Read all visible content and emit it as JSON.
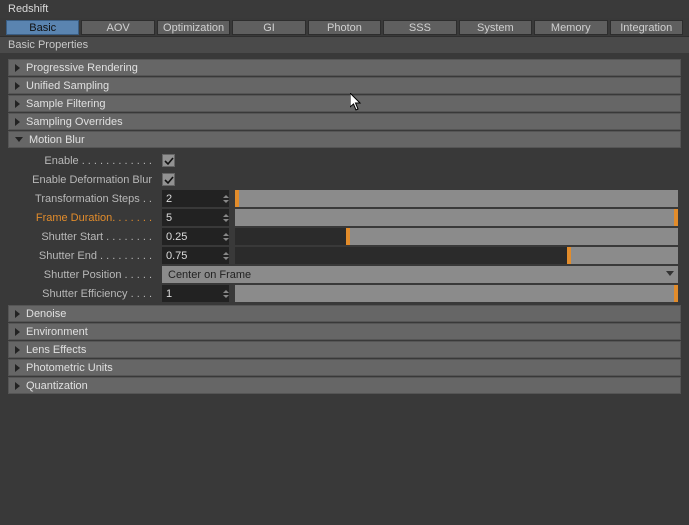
{
  "window": {
    "title": "Redshift"
  },
  "tabs": [
    {
      "label": "Basic",
      "active": true
    },
    {
      "label": "AOV"
    },
    {
      "label": "Optimization"
    },
    {
      "label": "GI"
    },
    {
      "label": "Photon"
    },
    {
      "label": "SSS"
    },
    {
      "label": "System"
    },
    {
      "label": "Memory"
    },
    {
      "label": "Integration"
    }
  ],
  "section": {
    "title": "Basic Properties"
  },
  "groups_top": [
    {
      "label": "Progressive Rendering"
    },
    {
      "label": "Unified Sampling"
    },
    {
      "label": "Sample Filtering"
    },
    {
      "label": "Sampling Overrides"
    }
  ],
  "motionblur": {
    "title": "Motion Blur",
    "enable": {
      "label": "Enable",
      "checked": true
    },
    "enable_deform": {
      "label": "Enable Deformation Blur",
      "checked": true
    },
    "transformation_steps": {
      "label": "Transformation Steps",
      "value": "2",
      "slider_fill_pct": 0,
      "slider_handle_pct": 0
    },
    "frame_duration": {
      "label": "Frame Duration",
      "value": "5",
      "slider_fill_pct": 100,
      "slider_handle_pct": 99
    },
    "shutter_start": {
      "label": "Shutter Start",
      "value": "0.25",
      "slider_fill_pct": 25,
      "slider_handle_pct": 25
    },
    "shutter_end": {
      "label": "Shutter End",
      "value": "0.75",
      "slider_fill_pct": 75,
      "slider_handle_pct": 75
    },
    "shutter_position": {
      "label": "Shutter Position",
      "value": "Center on Frame"
    },
    "shutter_efficiency": {
      "label": "Shutter Efficiency",
      "value": "1",
      "slider_fill_pct": 100,
      "slider_handle_pct": 99
    }
  },
  "groups_bottom": [
    {
      "label": "Denoise"
    },
    {
      "label": "Environment"
    },
    {
      "label": "Lens Effects"
    },
    {
      "label": "Photometric Units"
    },
    {
      "label": "Quantization"
    }
  ]
}
